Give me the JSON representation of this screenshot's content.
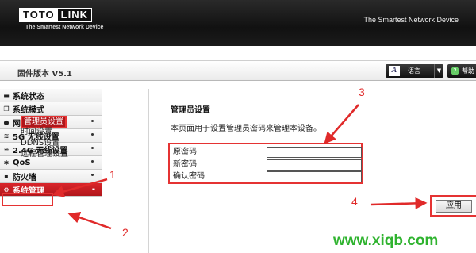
{
  "header": {
    "logo_left": "TOTO",
    "logo_right": "LINK",
    "logo_tagline": "The Smartest Network Device",
    "tagline": "The Smartest Network Device"
  },
  "toolbar": {
    "firmware_version": "固件版本 V5.1",
    "language_label": "语言",
    "language_icon": "A",
    "help_label": "帮助"
  },
  "sidebar": {
    "items": [
      {
        "label": "系统状态",
        "icon": "monitor-icon"
      },
      {
        "label": "系统模式",
        "icon": "copy-icon"
      },
      {
        "label": "网络设置",
        "icon": "globe-icon"
      },
      {
        "label": "5G 无线设置",
        "icon": "wifi-icon"
      },
      {
        "label": "2.4G 无线设置",
        "icon": "wifi-icon"
      },
      {
        "label": "QoS",
        "icon": "settings-icon"
      },
      {
        "label": "防火墙",
        "icon": "lock-icon"
      },
      {
        "label": "系统管理",
        "icon": "gear-icon",
        "active": true,
        "expand": "-"
      }
    ],
    "sub_items": [
      "管理员设置",
      "时间设置",
      "DDNS设置",
      "远程管理设置"
    ]
  },
  "content": {
    "title": "管理员设置",
    "description": "本页面用于设置管理员密码来管理本设备。",
    "fields": [
      {
        "label": "原密码",
        "value": ""
      },
      {
        "label": "新密码",
        "value": ""
      },
      {
        "label": "确认密码",
        "value": ""
      }
    ],
    "apply_label": "应用"
  },
  "annotations": [
    "1",
    "2",
    "3",
    "4"
  ],
  "colors": {
    "accent": "#d9252b",
    "annotation": "#e53333",
    "watermark": "#2fb32f"
  },
  "watermark": "www.xiqb.com"
}
